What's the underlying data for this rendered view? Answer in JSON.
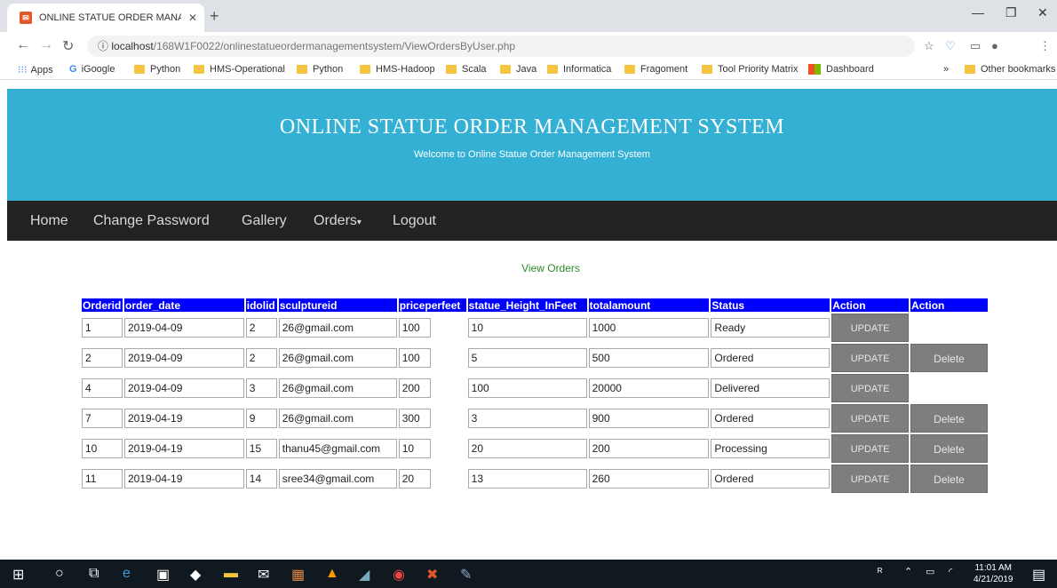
{
  "browser": {
    "tab_title": "ONLINE STATUE ORDER MANAG",
    "url_host": "localhost",
    "url_path": "/168W1F0022/onlinestatueordermanagementsystem/ViewOrdersByUser.php",
    "bookmarks": [
      "Apps",
      "iGoogle",
      "Python",
      "HMS-Operational",
      "Python",
      "HMS-Hadoop",
      "Scala",
      "Java",
      "Informatica",
      "Fragoment",
      "Tool Priority Matrix",
      "Dashboard"
    ],
    "other_bookmarks": "Other bookmarks",
    "overflow": "»"
  },
  "header": {
    "title": "ONLINE STATUE ORDER MANAGEMENT SYSTEM",
    "subtitle": "Welcome to Online Statue Order Management System",
    "bg_color": "#33b0d4"
  },
  "nav": {
    "items": [
      "Home",
      "Change Password",
      "Gallery",
      "Orders",
      "Logout"
    ]
  },
  "page": {
    "section_title": "View Orders"
  },
  "table": {
    "headers": [
      "Orderid",
      "order_date",
      "idolid",
      "sculptureid",
      "priceperfeet",
      "statue_Height_InFeet",
      "totalamount",
      "Status",
      "Action",
      "Action"
    ],
    "header_color": "#0000ff",
    "update_label": "UPDATE",
    "delete_label": "Delete",
    "rows": [
      {
        "orderid": "1",
        "date": "2019-04-09",
        "idolid": "2",
        "sculptureid": "26@gmail.com",
        "price": "100",
        "height": "10",
        "total": "1000",
        "status": "Ready",
        "delete": false
      },
      {
        "orderid": "2",
        "date": "2019-04-09",
        "idolid": "2",
        "sculptureid": "26@gmail.com",
        "price": "100",
        "height": "5",
        "total": "500",
        "status": "Ordered",
        "delete": true
      },
      {
        "orderid": "4",
        "date": "2019-04-09",
        "idolid": "3",
        "sculptureid": "26@gmail.com",
        "price": "200",
        "height": "100",
        "total": "20000",
        "status": "Delivered",
        "delete": false
      },
      {
        "orderid": "7",
        "date": "2019-04-19",
        "idolid": "9",
        "sculptureid": "26@gmail.com",
        "price": "300",
        "height": "3",
        "total": "900",
        "status": "Ordered",
        "delete": true
      },
      {
        "orderid": "10",
        "date": "2019-04-19",
        "idolid": "15",
        "sculptureid": "thanu45@gmail.com",
        "price": "10",
        "height": "20",
        "total": "200",
        "status": "Processing",
        "delete": true
      },
      {
        "orderid": "11",
        "date": "2019-04-19",
        "idolid": "14",
        "sculptureid": "sree34@gmail.com",
        "price": "20",
        "height": "13",
        "total": "260",
        "status": "Ordered",
        "delete": true
      }
    ]
  },
  "taskbar": {
    "time": "11:01 AM",
    "date": "4/21/2019"
  }
}
